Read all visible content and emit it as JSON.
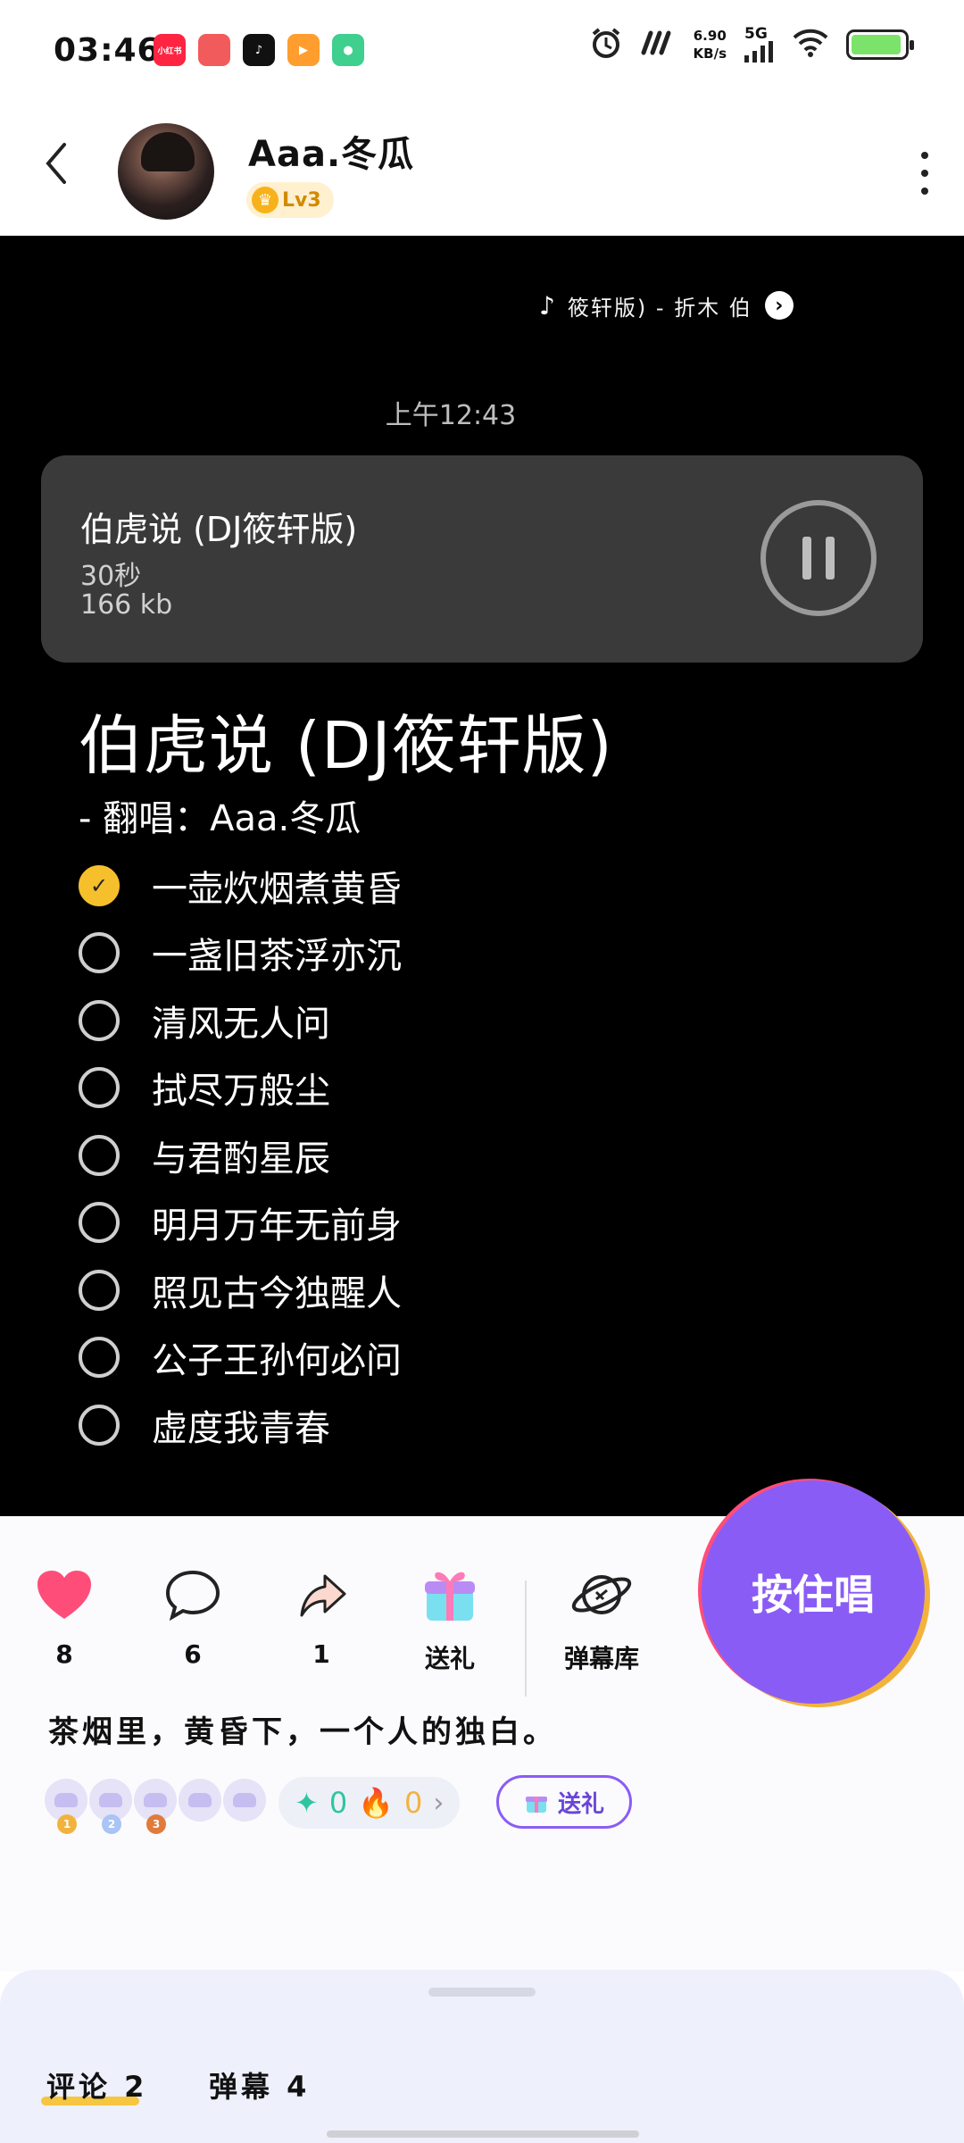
{
  "status_bar": {
    "time": "03:46",
    "net_speed_value": "6.90",
    "net_speed_unit": "KB/s",
    "network": "5G",
    "battery_level": 0.95,
    "app_icons": [
      {
        "name": "xiaohongshu-app-icon",
        "label": "小红书",
        "color": "#ff2442"
      },
      {
        "name": "maps-app-icon",
        "label": "",
        "color": "#f25b5b"
      },
      {
        "name": "tiktok-app-icon",
        "label": "♪",
        "color": "#111111"
      },
      {
        "name": "video-app-icon",
        "label": "▶",
        "color": "#ff9d2e"
      },
      {
        "name": "leaf-app-icon",
        "label": "●",
        "color": "#3fcf8e"
      }
    ]
  },
  "header": {
    "user_name": "Aaa.冬瓜",
    "level": "Lv3"
  },
  "media": {
    "now_playing": "筱轩版) - 折木   伯",
    "time_label": "上午12:43",
    "audio": {
      "title": "伯虎说 (DJ筱轩版)",
      "duration": "30秒",
      "size": "166 kb"
    },
    "lyrics_title": "伯虎说 (DJ筱轩版)",
    "lyrics_subtitle": "-  翻唱：Aaa.冬瓜",
    "lyrics": [
      {
        "text": "一壶炊烟煮黄昏",
        "checked": true
      },
      {
        "text": "一盏旧茶浮亦沉",
        "checked": false
      },
      {
        "text": "清风无人问",
        "checked": false
      },
      {
        "text": "拭尽万般尘",
        "checked": false
      },
      {
        "text": "与君酌星辰",
        "checked": false
      },
      {
        "text": "明月万年无前身",
        "checked": false
      },
      {
        "text": "照见古今独醒人",
        "checked": false
      },
      {
        "text": "公子王孙何必问",
        "checked": false
      },
      {
        "text": "虚度我青春",
        "checked": false
      }
    ],
    "progress": 0.04
  },
  "actions": {
    "like_count": "8",
    "comment_count": "6",
    "share_count": "1",
    "gift_label": "送礼",
    "danmaku_lib_label": "弹幕库",
    "sing_button": "按住唱"
  },
  "description": "茶烟里，黄昏下，一个人的独白。",
  "fans": {
    "medals": [
      "1",
      "2",
      "3"
    ]
  },
  "stats": {
    "diamonds": "0",
    "flames": "0",
    "arrow": "›"
  },
  "gift_pill_label": "送礼",
  "tabs": {
    "comments": "评论 2",
    "danmaku": "弹幕 4"
  },
  "colors": {
    "accent_purple": "#8a5cf6",
    "accent_yellow": "#f6c02c",
    "like_pink": "#ff4d7a"
  }
}
